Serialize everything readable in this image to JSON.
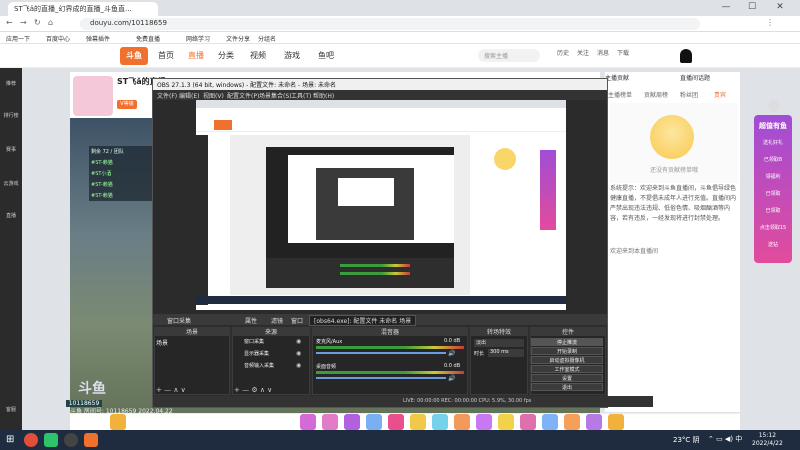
{
  "browser": {
    "tab_title": "ST飞ǎ的直播_幻界成的直播_斗鱼直...",
    "url": "douyu.com/10118659",
    "bookmarks": [
      "应用一下",
      "百度中心",
      "弹幕插件",
      "免费直播",
      "网络学习",
      "文件分享",
      "分组名"
    ]
  },
  "site": {
    "logo": "斗鱼",
    "nav": [
      "首页",
      "直播",
      "分类",
      "视频",
      "游戏",
      "鱼吧"
    ],
    "search_placeholder": "搜索主播",
    "top_icons": [
      "历史",
      "关注",
      "消息",
      "下载"
    ]
  },
  "sidebar": [
    "推荐",
    "排行榜",
    "赛事",
    "云游戏",
    "直播",
    "客服"
  ],
  "room": {
    "title": "ST飞ǎ的直播",
    "badge": "V等级",
    "room_number": "10118659",
    "footer": "斗鱼 房间号: 10118659 2022.04.22",
    "video_overlay_lines": [
      "剩余 72 / 团队",
      "#ST-赖猫",
      "#ST小酒",
      "#ST-赖猫",
      "#ST-赖猫"
    ]
  },
  "right_panel": {
    "tabs": [
      "主播榜单",
      "贡献周榜",
      "粉丝团",
      "贵宾",
      "钻粉",
      "粉丝团"
    ],
    "rank_header": "主播贡献",
    "rank_header_right": "直播间话题",
    "rank_empty": "还没有贡献榜单哦",
    "notice": "系统提示：欢迎来到斗鱼直播间，斗鱼倡导绿色健康直播，不提倡未成年人进行充值。直播间内严禁出现违法违规、低俗色情、吸烟酗酒等内容，若有违反，一经发现将进行封禁处理。",
    "welcome": "欢迎来到本直播间"
  },
  "promo": {
    "title": "超值有鱼",
    "items": [
      "送礼好礼",
      "已领取8",
      "领福利",
      "已领取",
      "已领取",
      "点击领取15",
      "送钻"
    ]
  },
  "obs": {
    "title": "OBS 27.1.3 (64 bit, windows) - 配置文件: 未命名 - 场景: 未命名",
    "menu": [
      "文件(F)",
      "编辑(E)",
      "视图(V)",
      "配置文件(P)",
      "场景集合(S)",
      "工具(T)",
      "帮助(H)"
    ],
    "crumb": [
      "窗口采集",
      "属性",
      "滤镜",
      "窗口",
      "[obs64.exe]: 配置文件 未命名 场景"
    ],
    "docks": [
      "场景",
      "来源",
      "混音器",
      "转场特效",
      "控件"
    ],
    "scene_item": "场景",
    "sources": [
      "窗口采集",
      "显示器采集",
      "音频输入采集"
    ],
    "mixer": [
      {
        "label": "桌面音频",
        "db": "0.0 dB"
      },
      {
        "label": "麦克风/Aux",
        "db": "0.0 dB"
      }
    ],
    "transition": {
      "type": "淡出",
      "duration_label": "时长",
      "duration": "300 ms"
    },
    "controls": [
      "停止推流",
      "开始录制",
      "启动虚拟摄像机",
      "工作室模式",
      "设置",
      "退出"
    ],
    "status": "LIVE: 00:00:00  REC: 00:00:00  CPU: 5.9%, 30.00 fps"
  },
  "taskbar": {
    "weather": "23°C 阴",
    "time": "15:12",
    "date": "2022/4/22"
  }
}
